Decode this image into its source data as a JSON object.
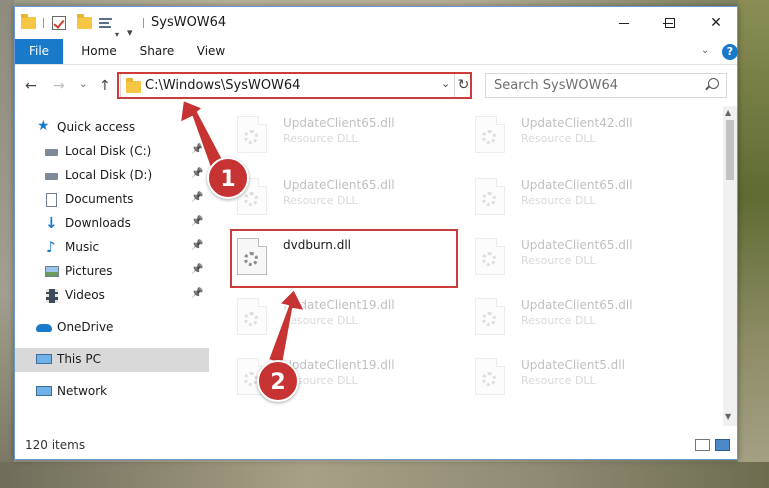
{
  "window": {
    "title": "SysWOW64",
    "min_icon": "minimize-icon",
    "max_icon": "maximize-icon",
    "close_glyph": "✕"
  },
  "ribbon": {
    "tabs": [
      "File",
      "Home",
      "Share",
      "View"
    ],
    "help_glyph": "?",
    "chevron_glyph": "⌄"
  },
  "nav": {
    "back_glyph": "←",
    "forward_glyph": "→",
    "recent_glyph": "⌄",
    "up_glyph": "↑",
    "address": "C:\\Windows\\SysWOW64",
    "address_dd_glyph": "⌄",
    "refresh_glyph": "↻",
    "search_placeholder": "Search SysWOW64"
  },
  "sidebar": {
    "items": [
      {
        "label": "Quick access",
        "icon": "star-icon"
      },
      {
        "label": "Local Disk (C:)",
        "icon": "drive-icon",
        "pinned": true
      },
      {
        "label": "Local Disk (D:)",
        "icon": "drive-icon",
        "pinned": true
      },
      {
        "label": "Documents",
        "icon": "documents-icon",
        "pinned": true
      },
      {
        "label": "Downloads",
        "icon": "download-icon",
        "pinned": true
      },
      {
        "label": "Music",
        "icon": "music-icon",
        "pinned": true
      },
      {
        "label": "Pictures",
        "icon": "pictures-icon",
        "pinned": true
      },
      {
        "label": "Videos",
        "icon": "videos-icon",
        "pinned": true
      },
      {
        "label": "OneDrive",
        "icon": "cloud-icon"
      },
      {
        "label": "This PC",
        "icon": "monitor-icon",
        "selected": true
      },
      {
        "label": "Network",
        "icon": "network-icon"
      }
    ],
    "pin_glyph": "📌"
  },
  "files": [
    {
      "name": "UpdateClient65.dll",
      "type": "Resource DLL"
    },
    {
      "name": "UpdateClient42.dll",
      "type": "Resource DLL"
    },
    {
      "name": "UpdateClient65.dll",
      "type": "Resource DLL"
    },
    {
      "name": "UpdateClient65.dll",
      "type": "Resource DLL"
    },
    {
      "name": "dvdburn.dll",
      "type": ""
    },
    {
      "name": "UpdateClient65.dll",
      "type": "Resource DLL"
    },
    {
      "name": "UpdateClient19.dll",
      "type": "Resource DLL"
    },
    {
      "name": "UpdateClient65.dll",
      "type": "Resource DLL"
    },
    {
      "name": "UpdateClient19.dll",
      "type": "Resource DLL"
    },
    {
      "name": "UpdateClient5.dll",
      "type": "Resource DLL"
    }
  ],
  "status": {
    "item_count": "120 items"
  },
  "annotations": {
    "badge_1": "1",
    "badge_2": "2"
  },
  "colors": {
    "accent": "#1979ca",
    "highlight": "#cf3a3a",
    "badge": "#c73333"
  }
}
